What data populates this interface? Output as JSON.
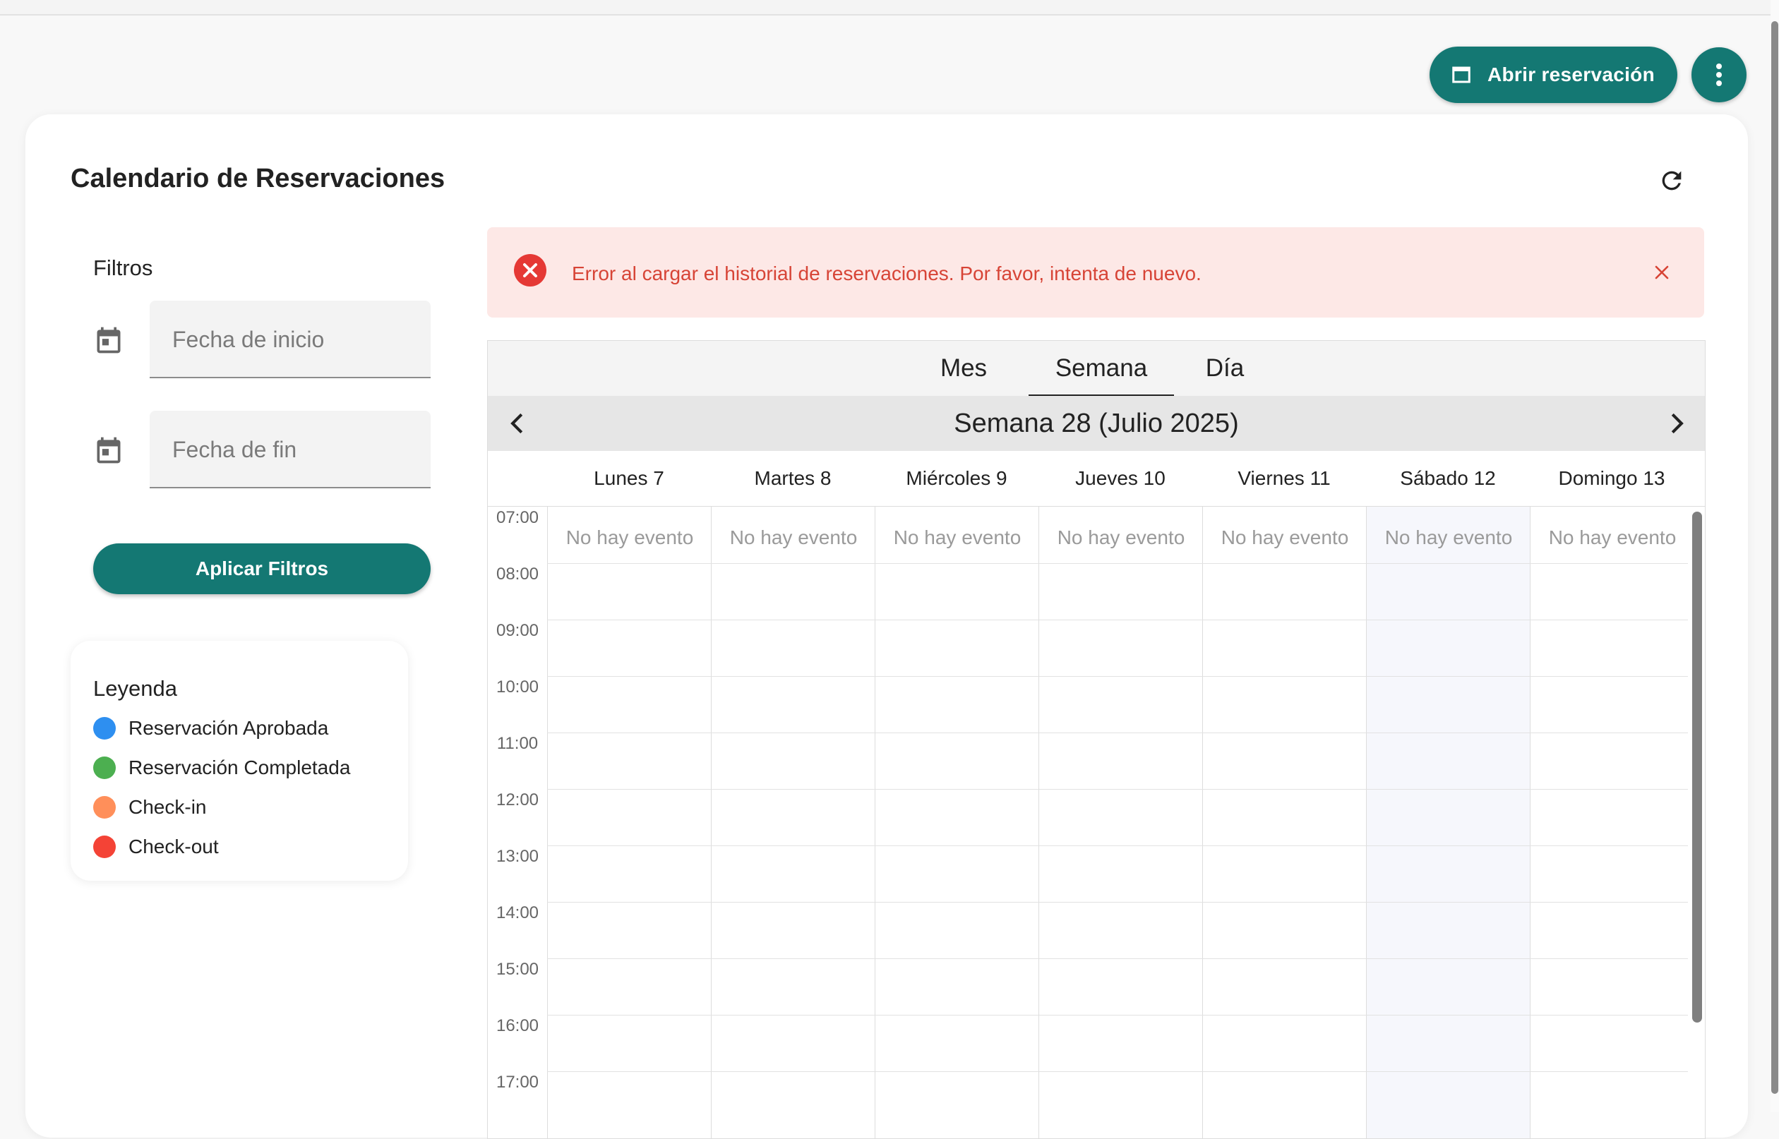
{
  "header": {
    "open_reservation_label": "Abrir reservación",
    "open_reservation_icon": "window-icon",
    "more_icon": "more-vert-icon",
    "accent_color": "#147873"
  },
  "card": {
    "title": "Calendario de Reservaciones",
    "refresh_icon": "refresh-icon"
  },
  "filters": {
    "title": "Filtros",
    "start_date_placeholder": "Fecha de inicio",
    "end_date_placeholder": "Fecha de fin",
    "apply_label": "Aplicar Filtros"
  },
  "legend": {
    "title": "Leyenda",
    "items": [
      {
        "label": "Reservación Aprobada",
        "color": "#2e8ff0"
      },
      {
        "label": "Reservación Completada",
        "color": "#4caf50"
      },
      {
        "label": "Check-in",
        "color": "#ff8f5a"
      },
      {
        "label": "Check-out",
        "color": "#f44336"
      }
    ]
  },
  "alert": {
    "message": "Error al cargar el historial de reservaciones. Por favor, intenta de nuevo.",
    "color": "#d74436",
    "background": "#fde8e6"
  },
  "calendar": {
    "tabs": [
      {
        "label": "Mes",
        "active": false
      },
      {
        "label": "Semana",
        "active": true
      },
      {
        "label": "Día",
        "active": false
      }
    ],
    "week_title": "Semana 28 (Julio 2025)",
    "days": [
      "Lunes 7",
      "Martes 8",
      "Miércoles 9",
      "Jueves 10",
      "Viernes 11",
      "Sábado 12",
      "Domingo 13"
    ],
    "no_event_label": "No hay evento",
    "hours": [
      "07:00",
      "08:00",
      "09:00",
      "10:00",
      "11:00",
      "12:00",
      "13:00",
      "14:00",
      "15:00",
      "16:00",
      "17:00"
    ]
  }
}
